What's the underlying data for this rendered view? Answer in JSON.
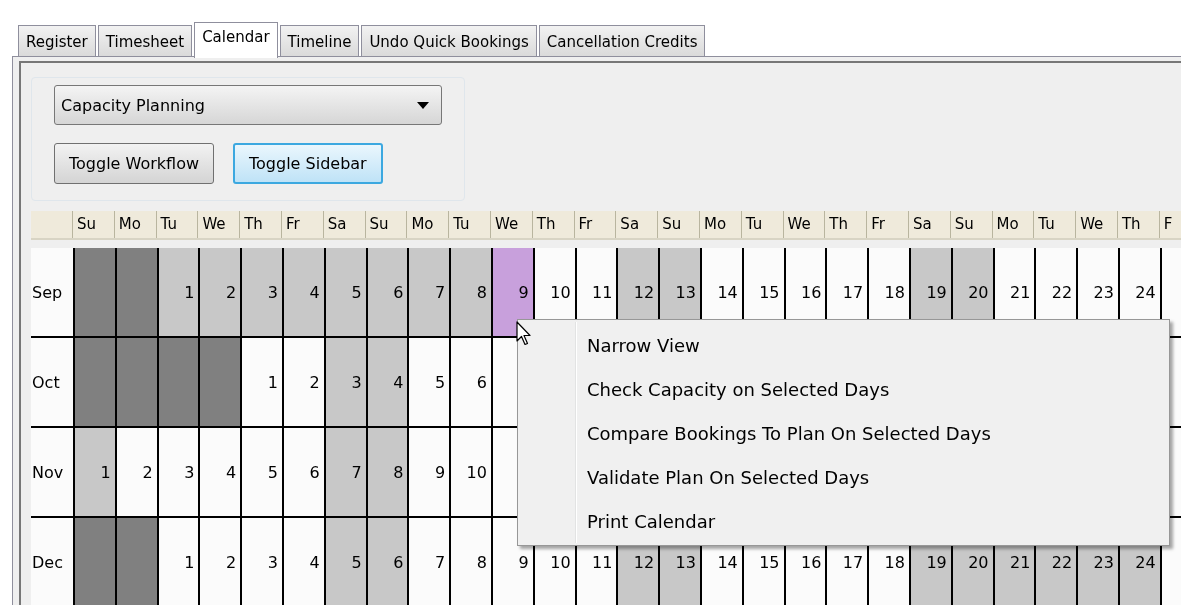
{
  "tabs": [
    {
      "label": "Register",
      "selected": false
    },
    {
      "label": "Timesheet",
      "selected": false
    },
    {
      "label": "Calendar",
      "selected": true
    },
    {
      "label": "Timeline",
      "selected": false
    },
    {
      "label": "Undo Quick Bookings",
      "selected": false
    },
    {
      "label": "Cancellation Credits",
      "selected": false
    }
  ],
  "view_dropdown": {
    "value": "Capacity Planning"
  },
  "buttons": [
    {
      "label": "Toggle Workflow",
      "focused": false
    },
    {
      "label": "Toggle Sidebar",
      "focused": true
    }
  ],
  "weekdays": [
    "Su",
    "Mo",
    "Tu",
    "We",
    "Th",
    "Fr",
    "Sa",
    "Su",
    "Mo",
    "Tu",
    "We",
    "Th",
    "Fr",
    "Sa",
    "Su",
    "Mo",
    "Tu",
    "We",
    "Th",
    "Fr",
    "Sa",
    "Su",
    "Mo",
    "Tu",
    "We",
    "Th",
    "F"
  ],
  "months": [
    {
      "label": "Sep",
      "cells": [
        {
          "kind": "outside",
          "selected": false
        },
        {
          "kind": "outside",
          "selected": false
        },
        {
          "day": "1",
          "kind": "shaded",
          "selected": false
        },
        {
          "day": "2",
          "kind": "shaded",
          "selected": false
        },
        {
          "day": "3",
          "kind": "shaded",
          "selected": false
        },
        {
          "day": "4",
          "kind": "shaded",
          "selected": false
        },
        {
          "day": "5",
          "kind": "shaded",
          "selected": false
        },
        {
          "day": "6",
          "kind": "shaded",
          "selected": false
        },
        {
          "day": "7",
          "kind": "shaded",
          "selected": false
        },
        {
          "day": "8",
          "kind": "shaded",
          "selected": false
        },
        {
          "day": "9",
          "kind": "plain",
          "selected": true
        },
        {
          "day": "10",
          "kind": "plain",
          "selected": false
        },
        {
          "day": "11",
          "kind": "plain",
          "selected": false
        },
        {
          "day": "12",
          "kind": "shaded",
          "selected": false
        },
        {
          "day": "13",
          "kind": "shaded",
          "selected": false
        },
        {
          "day": "14",
          "kind": "plain",
          "selected": false
        },
        {
          "day": "15",
          "kind": "plain",
          "selected": false
        },
        {
          "day": "16",
          "kind": "plain",
          "selected": false
        },
        {
          "day": "17",
          "kind": "plain",
          "selected": false
        },
        {
          "day": "18",
          "kind": "plain",
          "selected": false
        },
        {
          "day": "19",
          "kind": "shaded",
          "selected": false
        },
        {
          "day": "20",
          "kind": "shaded",
          "selected": false
        },
        {
          "day": "21",
          "kind": "plain",
          "selected": false
        },
        {
          "day": "22",
          "kind": "plain",
          "selected": false
        },
        {
          "day": "23",
          "kind": "plain",
          "selected": false
        },
        {
          "day": "24",
          "kind": "plain",
          "selected": false
        }
      ]
    },
    {
      "label": "Oct",
      "cells": [
        {
          "kind": "outside",
          "selected": false
        },
        {
          "kind": "outside",
          "selected": false
        },
        {
          "kind": "outside",
          "selected": false
        },
        {
          "kind": "outside",
          "selected": false
        },
        {
          "day": "1",
          "kind": "plain",
          "selected": false
        },
        {
          "day": "2",
          "kind": "plain",
          "selected": false
        },
        {
          "day": "3",
          "kind": "shaded",
          "selected": false
        },
        {
          "day": "4",
          "kind": "shaded",
          "selected": false
        },
        {
          "day": "5",
          "kind": "plain",
          "selected": false
        },
        {
          "day": "6",
          "kind": "plain",
          "selected": false
        },
        {
          "kind": "plain",
          "selected": false
        }
      ]
    },
    {
      "label": "Nov",
      "cells": [
        {
          "day": "1",
          "kind": "shaded",
          "selected": false
        },
        {
          "day": "2",
          "kind": "plain",
          "selected": false
        },
        {
          "day": "3",
          "kind": "plain",
          "selected": false
        },
        {
          "day": "4",
          "kind": "plain",
          "selected": false
        },
        {
          "day": "5",
          "kind": "plain",
          "selected": false
        },
        {
          "day": "6",
          "kind": "plain",
          "selected": false
        },
        {
          "day": "7",
          "kind": "shaded",
          "selected": false
        },
        {
          "day": "8",
          "kind": "shaded",
          "selected": false
        },
        {
          "day": "9",
          "kind": "plain",
          "selected": false
        },
        {
          "day": "10",
          "kind": "plain",
          "selected": false
        },
        {
          "kind": "plain",
          "selected": false
        }
      ]
    },
    {
      "label": "Dec",
      "cells": [
        {
          "kind": "outside",
          "selected": false
        },
        {
          "kind": "outside",
          "selected": false
        },
        {
          "day": "1",
          "kind": "plain",
          "selected": false
        },
        {
          "day": "2",
          "kind": "plain",
          "selected": false
        },
        {
          "day": "3",
          "kind": "plain",
          "selected": false
        },
        {
          "day": "4",
          "kind": "plain",
          "selected": false
        },
        {
          "day": "5",
          "kind": "shaded",
          "selected": false
        },
        {
          "day": "6",
          "kind": "shaded",
          "selected": false
        },
        {
          "day": "7",
          "kind": "plain",
          "selected": false
        },
        {
          "day": "8",
          "kind": "plain",
          "selected": false
        },
        {
          "day": "9",
          "kind": "plain",
          "selected": false
        },
        {
          "day": "10",
          "kind": "plain",
          "selected": false
        },
        {
          "day": "11",
          "kind": "plain",
          "selected": false
        },
        {
          "day": "12",
          "kind": "shaded",
          "selected": false
        },
        {
          "day": "13",
          "kind": "shaded",
          "selected": false
        },
        {
          "day": "14",
          "kind": "plain",
          "selected": false
        },
        {
          "day": "15",
          "kind": "plain",
          "selected": false
        },
        {
          "day": "16",
          "kind": "plain",
          "selected": false
        },
        {
          "day": "17",
          "kind": "plain",
          "selected": false
        },
        {
          "day": "18",
          "kind": "plain",
          "selected": false
        },
        {
          "day": "19",
          "kind": "shaded",
          "selected": false
        },
        {
          "day": "20",
          "kind": "shaded",
          "selected": false
        },
        {
          "day": "21",
          "kind": "shaded",
          "selected": false
        },
        {
          "day": "22",
          "kind": "shaded",
          "selected": false
        },
        {
          "day": "23",
          "kind": "shaded",
          "selected": false
        },
        {
          "day": "24",
          "kind": "shaded",
          "selected": false
        }
      ]
    }
  ],
  "context_menu": {
    "items": [
      "Narrow View",
      "Check Capacity on Selected Days",
      "Compare Bookings To Plan On Selected Days",
      "Validate Plan On Selected Days",
      "Print Calendar"
    ]
  }
}
